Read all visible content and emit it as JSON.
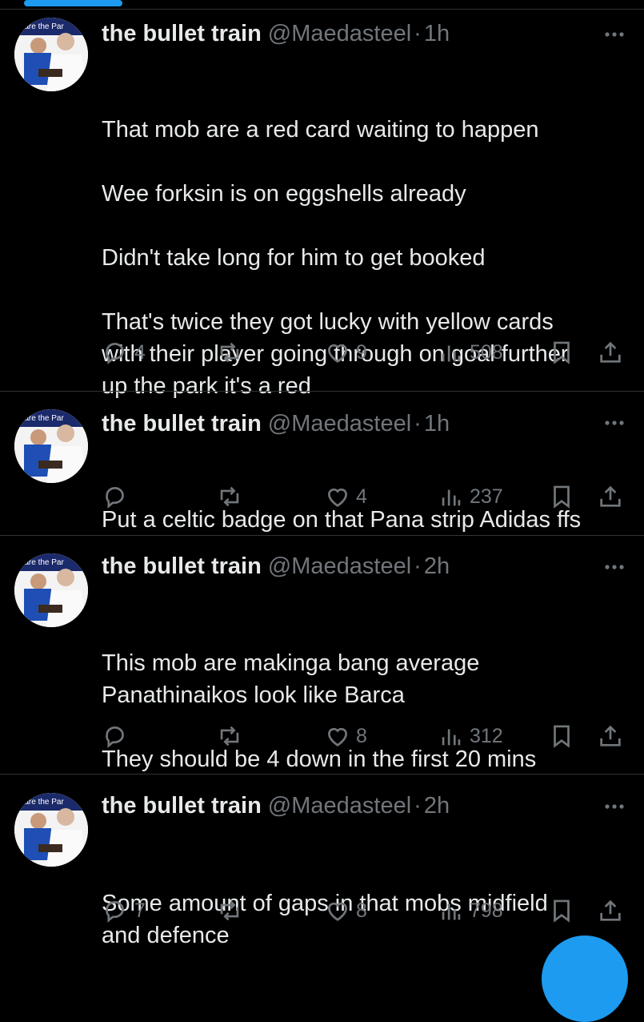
{
  "tweets": [
    {
      "name": "the bullet train",
      "handle": "@Maedasteel",
      "time": "1h",
      "lines": [
        "That mob are a red card waiting to happen",
        "",
        "Wee forksin is on eggshells already",
        "",
        "Didn't take long for him to get booked",
        "",
        "That's twice they got lucky with yellow cards",
        "with their player going through on goal further",
        "up the park it's a red"
      ],
      "replies": "4",
      "reposts": "",
      "likes": "9",
      "views": "508"
    },
    {
      "name": "the bullet train",
      "handle": "@Maedasteel",
      "time": "1h",
      "lines": [
        "Put a celtic badge on that Pana strip Adidas ffs"
      ],
      "replies": "",
      "reposts": "",
      "likes": "4",
      "views": "237"
    },
    {
      "name": "the bullet train",
      "handle": "@Maedasteel",
      "time": "2h",
      "lines": [
        "This mob are makinga bang average",
        "Panathinaikos look like Barca",
        "",
        "They should be 4 down in the first 20 mins"
      ],
      "replies": "",
      "reposts": "",
      "likes": "8",
      "views": "312"
    },
    {
      "name": "the bullet train",
      "handle": "@Maedasteel",
      "time": "2h",
      "lines": [
        "Some amount of gaps in that mobs midfield",
        "and defence"
      ],
      "replies": "7",
      "reposts": "",
      "likes": "8",
      "views": "798"
    }
  ],
  "avatar_caption": "e are the Par",
  "colors": {
    "background": "#000000",
    "text": "#e7e9ea",
    "muted": "#71767b",
    "accent": "#1d9bf0",
    "divider": "#2f3336"
  }
}
